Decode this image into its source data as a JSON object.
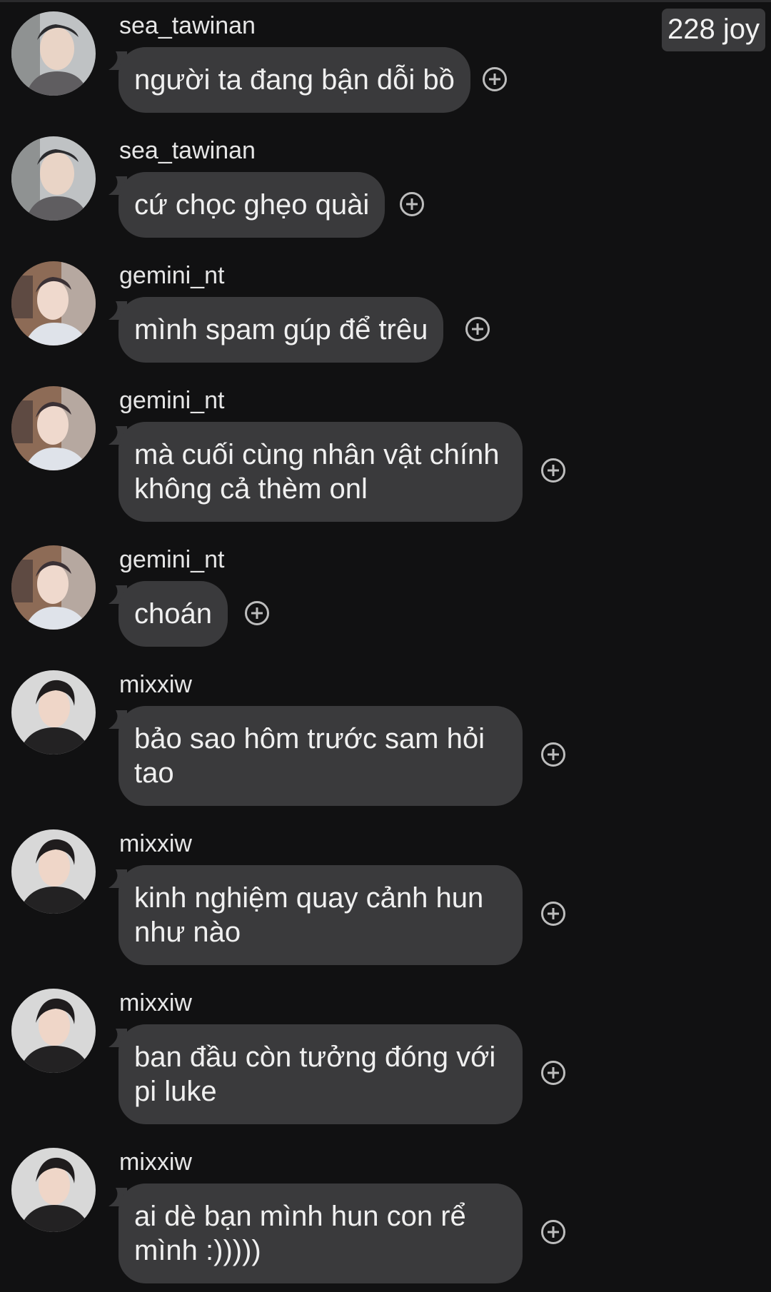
{
  "header": {
    "joy_badge": "228 joy"
  },
  "messages": [
    {
      "username": "sea_tawinan",
      "text": "người ta đang bận dỗi bồ",
      "avatar": "avatar-sea"
    },
    {
      "username": "sea_tawinan",
      "text": "cứ chọc ghẹo quài",
      "avatar": "avatar-sea"
    },
    {
      "username": "gemini_nt",
      "text": "mình spam gúp để trêu",
      "avatar": "avatar-gemini"
    },
    {
      "username": "gemini_nt",
      "text": "mà cuối cùng nhân vật chính không cả thèm onl",
      "avatar": "avatar-gemini"
    },
    {
      "username": "gemini_nt",
      "text": "choán",
      "avatar": "avatar-gemini"
    },
    {
      "username": "mixxiw",
      "text": "bảo sao hôm trước sam hỏi tao",
      "avatar": "avatar-mixxiw"
    },
    {
      "username": "mixxiw",
      "text": "kinh nghiệm quay cảnh hun như nào",
      "avatar": "avatar-mixxiw"
    },
    {
      "username": "mixxiw",
      "text": "ban đầu còn tưởng đóng với pi luke",
      "avatar": "avatar-mixxiw"
    },
    {
      "username": "mixxiw",
      "text": "ai dè bạn mình hun con rể mình :)))))",
      "avatar": "avatar-mixxiw"
    }
  ],
  "colors": {
    "background": "#111112",
    "bubble": "#3a3a3c",
    "text": "#f0f0f0",
    "icon": "#bdbdbd"
  },
  "icons": {
    "react": "add-reaction-icon"
  }
}
